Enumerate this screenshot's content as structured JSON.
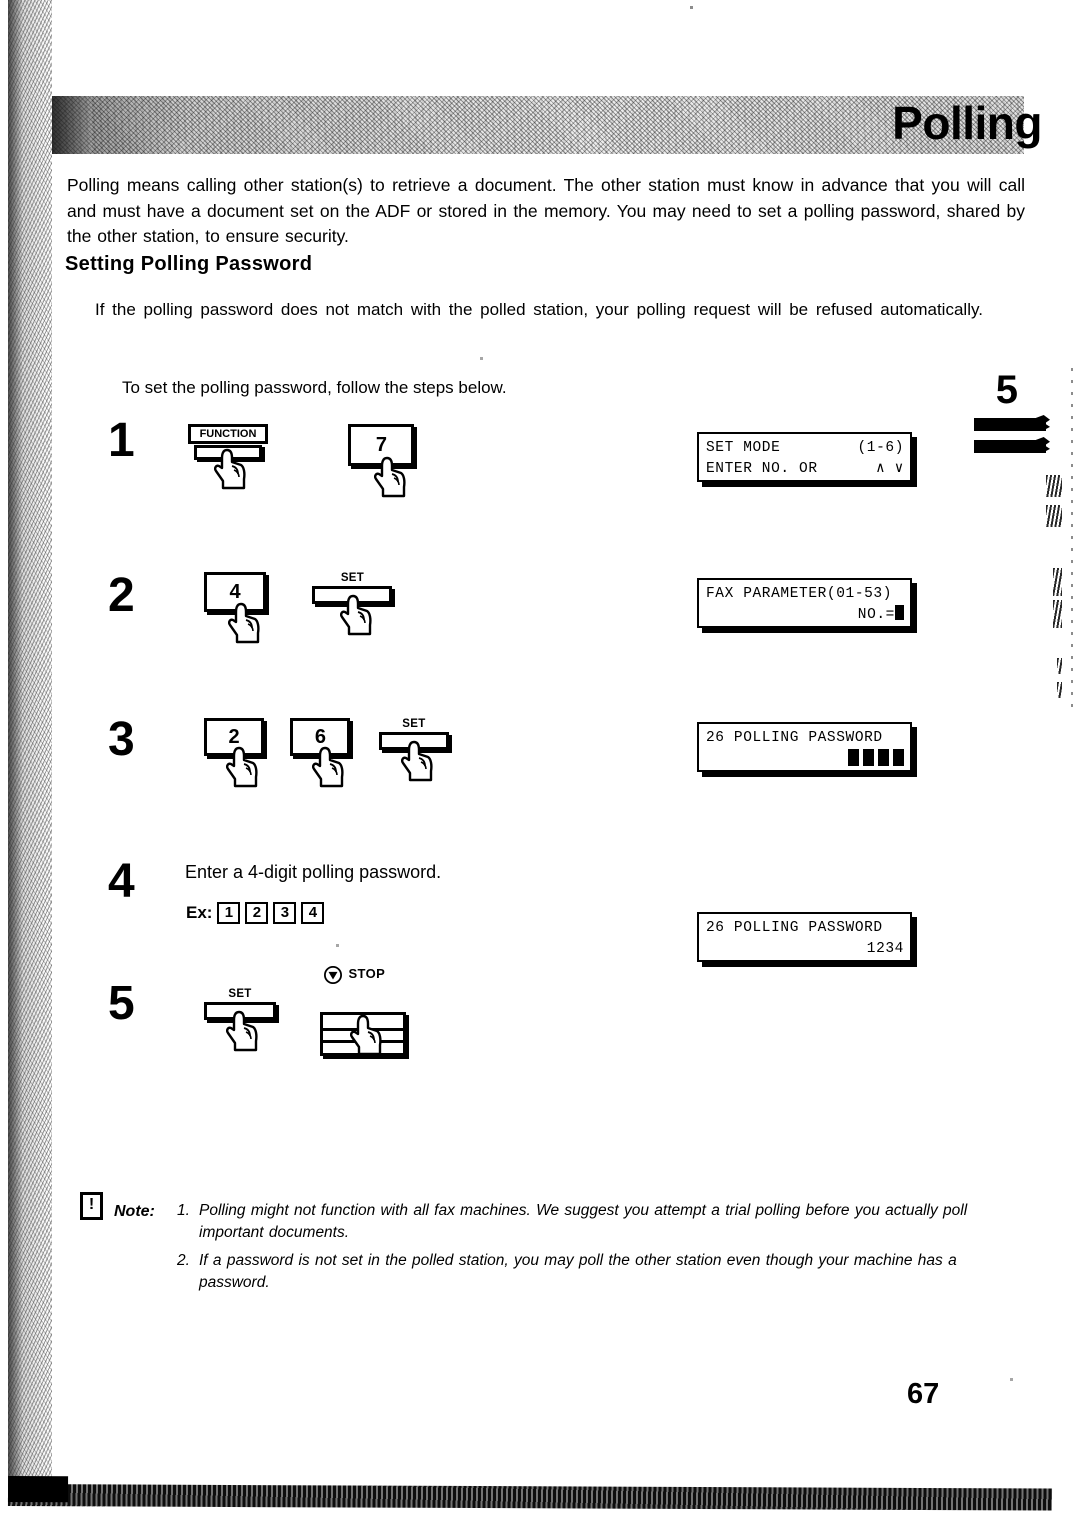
{
  "document": {
    "chapter_title": "Polling",
    "page_number": "67",
    "margin_tab_number": "5",
    "chapter_marker_number": "5"
  },
  "intro": {
    "paragraph": "Polling means calling other station(s) to retrieve a document.  The other station must know in advance that you will call and must have a document set on the ADF or stored in the memory.  You may need to set a polling password, shared by the other station, to ensure security."
  },
  "section": {
    "heading": "Setting Polling Password",
    "paragraph": "If the polling password does not match with the polled station, your polling request will be refused automatically.",
    "lead_in": "To set the polling password, follow the steps below."
  },
  "steps": [
    {
      "number": "1",
      "keys": [
        {
          "type": "function",
          "label": "FUNCTION"
        },
        {
          "type": "digit",
          "label": "7"
        }
      ],
      "lcd": {
        "line1_left": "SET MODE",
        "line1_right": "(1-6)",
        "line2_left": "ENTER NO. OR",
        "line2_right": "∧ ∨"
      }
    },
    {
      "number": "2",
      "keys": [
        {
          "type": "digit",
          "label": "4"
        },
        {
          "type": "bar",
          "label": "SET"
        }
      ],
      "lcd": {
        "line1_left": "FAX PARAMETER(01-53)",
        "line2_right": "NO.="
      }
    },
    {
      "number": "3",
      "keys": [
        {
          "type": "digit",
          "label": "2"
        },
        {
          "type": "digit",
          "label": "6"
        },
        {
          "type": "bar",
          "label": "SET"
        }
      ],
      "lcd": {
        "line1_left": "26 POLLING PASSWORD",
        "line2_right_blocks": 4
      }
    },
    {
      "number": "4",
      "instruction": "Enter a 4-digit polling password.",
      "example_label": "Ex:",
      "example_keys": [
        "1",
        "2",
        "3",
        "4"
      ],
      "lcd": {
        "line1_left": "26 POLLING PASSWORD",
        "line2_right": "1234"
      }
    },
    {
      "number": "5",
      "keys": [
        {
          "type": "bar",
          "label": "SET"
        },
        {
          "type": "stop",
          "label": "STOP",
          "icon": "stop-triangle-icon"
        }
      ]
    }
  ],
  "note": {
    "icon": "exclamation-note-icon",
    "icon_glyph": "!",
    "label": "Note:",
    "items": [
      {
        "number": "1.",
        "text": "Polling might not function with all fax machines.  We suggest you attempt a trial polling before you actually poll important documents."
      },
      {
        "number": "2.",
        "text": "If a password is not set in the polled station, you may poll the other station even though your machine has a password."
      }
    ]
  }
}
